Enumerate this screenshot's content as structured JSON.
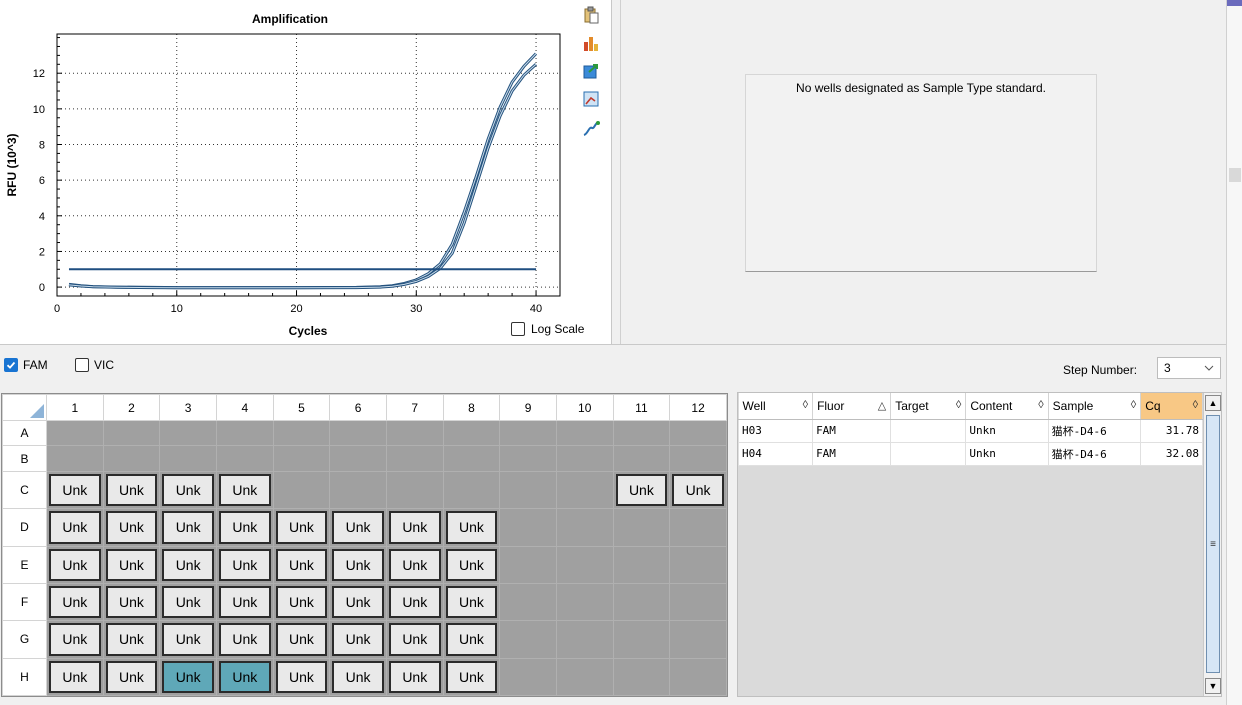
{
  "chart_data": {
    "type": "line",
    "title": "Amplification",
    "xlabel": "Cycles",
    "ylabel": "RFU (10^3)",
    "xlim": [
      0,
      42
    ],
    "ylim": [
      -0.5,
      14.2
    ],
    "xticks": [
      0,
      10,
      20,
      30,
      40
    ],
    "yticks": [
      0,
      2,
      4,
      6,
      8,
      10,
      12
    ],
    "grid": true,
    "threshold": 1.0,
    "series": [
      {
        "color": "#4e7fac",
        "x": [
          1,
          2,
          3,
          5,
          8,
          10,
          15,
          20,
          25,
          27,
          28,
          29,
          30,
          31,
          32,
          33,
          34,
          35,
          36,
          37,
          38,
          39,
          40
        ],
        "y": [
          0.15,
          0.08,
          0.03,
          0.0,
          -0.02,
          -0.03,
          -0.03,
          -0.03,
          -0.02,
          0.02,
          0.08,
          0.2,
          0.4,
          0.75,
          1.3,
          2.4,
          4.2,
          6.2,
          8.3,
          10.1,
          11.5,
          12.4,
          13.1
        ]
      },
      {
        "color": "#4e7fac",
        "x": [
          1,
          2,
          3,
          5,
          8,
          10,
          15,
          20,
          25,
          27,
          28,
          29,
          30,
          31,
          32,
          33,
          34,
          35,
          36,
          37,
          38,
          39,
          40
        ],
        "y": [
          0.12,
          0.06,
          0.02,
          -0.01,
          -0.03,
          -0.04,
          -0.04,
          -0.04,
          -0.03,
          0.0,
          0.05,
          0.15,
          0.32,
          0.6,
          1.05,
          1.9,
          3.6,
          5.7,
          7.8,
          9.6,
          11.0,
          11.9,
          12.5
        ]
      }
    ]
  },
  "log_scale": {
    "label": "Log Scale",
    "checked": false
  },
  "toolbar_icons": [
    "clipboard-icon",
    "bar-chart-icon",
    "export-icon",
    "zoom-icon",
    "curve-icon"
  ],
  "std_curve": {
    "message": "No wells designated as Sample Type standard."
  },
  "fluors": [
    {
      "label": "FAM",
      "checked": true
    },
    {
      "label": "VIC",
      "checked": false
    }
  ],
  "step": {
    "label": "Step Number:",
    "value": "3"
  },
  "plate": {
    "columns": [
      "1",
      "2",
      "3",
      "4",
      "5",
      "6",
      "7",
      "8",
      "9",
      "10",
      "11",
      "12"
    ],
    "rows": [
      "A",
      "B",
      "C",
      "D",
      "E",
      "F",
      "G",
      "H"
    ],
    "well_label": "Unk",
    "filled": {
      "A": [],
      "B": [],
      "C": [
        1,
        2,
        3,
        4,
        11,
        12
      ],
      "D": [
        1,
        2,
        3,
        4,
        5,
        6,
        7,
        8
      ],
      "E": [
        1,
        2,
        3,
        4,
        5,
        6,
        7,
        8
      ],
      "F": [
        1,
        2,
        3,
        4,
        5,
        6,
        7,
        8
      ],
      "G": [
        1,
        2,
        3,
        4,
        5,
        6,
        7,
        8
      ],
      "H": [
        1,
        2,
        3,
        4,
        5,
        6,
        7,
        8
      ]
    },
    "selected": [
      "H3",
      "H4"
    ]
  },
  "results": {
    "columns": [
      {
        "label": "Well",
        "sort": "◊"
      },
      {
        "label": "Fluor",
        "sort": "△"
      },
      {
        "label": "Target",
        "sort": "◊"
      },
      {
        "label": "Content",
        "sort": "◊"
      },
      {
        "label": "Sample",
        "sort": "◊"
      },
      {
        "label": "Cq",
        "sort": "◊"
      }
    ],
    "rows": [
      [
        "H03",
        "FAM",
        "",
        "Unkn",
        "猫杯-D4-6",
        "31.78"
      ],
      [
        "H04",
        "FAM",
        "",
        "Unkn",
        "猫杯-D4-6",
        "32.08"
      ]
    ]
  }
}
